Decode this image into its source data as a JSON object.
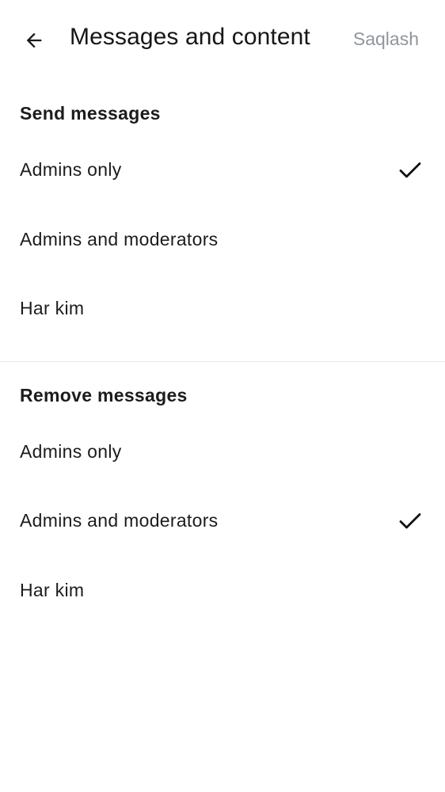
{
  "header": {
    "title": "Messages and content",
    "save_label": "Saqlash"
  },
  "send_messages": {
    "heading": "Send messages",
    "options": [
      {
        "label": "Admins only",
        "selected": true
      },
      {
        "label": "Admins and moderators",
        "selected": false
      },
      {
        "label": "Har kim",
        "selected": false
      }
    ]
  },
  "remove_messages": {
    "heading": "Remove messages",
    "options": [
      {
        "label": "Admins only",
        "selected": false
      },
      {
        "label": "Admins and moderators",
        "selected": true
      },
      {
        "label": "Har kim",
        "selected": false
      }
    ]
  },
  "icons": {
    "back": "arrow-left-icon",
    "check": "checkmark-icon"
  }
}
